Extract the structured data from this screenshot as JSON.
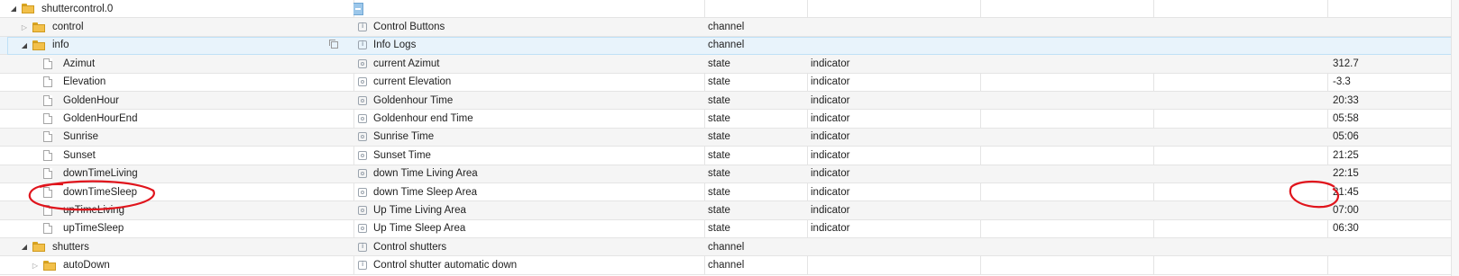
{
  "tree": {
    "rows": [
      {
        "name": "shuttercontrol.0",
        "kind": "folder",
        "arrow": "expanded",
        "indent": 0,
        "desc": "",
        "desc_icon": "header-button",
        "type": "",
        "role": "",
        "value": "",
        "selected": false
      },
      {
        "name": "control",
        "kind": "folder",
        "arrow": "collapsed",
        "indent": 1,
        "desc": "Control Buttons",
        "desc_icon": "info",
        "type": "channel",
        "role": "",
        "value": "",
        "selected": false
      },
      {
        "name": "info",
        "kind": "folder",
        "arrow": "expanded",
        "indent": 1,
        "desc": "Info Logs",
        "desc_icon": "info",
        "type": "channel",
        "role": "",
        "value": "",
        "selected": true
      },
      {
        "name": "Azimut",
        "kind": "state",
        "arrow": "",
        "indent": 2,
        "desc": "current Azimut",
        "desc_icon": "state",
        "type": "state",
        "role": "indicator",
        "value": "312.7",
        "selected": false
      },
      {
        "name": "Elevation",
        "kind": "state",
        "arrow": "",
        "indent": 2,
        "desc": "current Elevation",
        "desc_icon": "state",
        "type": "state",
        "role": "indicator",
        "value": "-3.3",
        "selected": false
      },
      {
        "name": "GoldenHour",
        "kind": "state",
        "arrow": "",
        "indent": 2,
        "desc": "Goldenhour Time",
        "desc_icon": "state",
        "type": "state",
        "role": "indicator",
        "value": "20:33",
        "selected": false
      },
      {
        "name": "GoldenHourEnd",
        "kind": "state",
        "arrow": "",
        "indent": 2,
        "desc": "Goldenhour end Time",
        "desc_icon": "state",
        "type": "state",
        "role": "indicator",
        "value": "05:58",
        "selected": false
      },
      {
        "name": "Sunrise",
        "kind": "state",
        "arrow": "",
        "indent": 2,
        "desc": "Sunrise Time",
        "desc_icon": "state",
        "type": "state",
        "role": "indicator",
        "value": "05:06",
        "selected": false
      },
      {
        "name": "Sunset",
        "kind": "state",
        "arrow": "",
        "indent": 2,
        "desc": "Sunset Time",
        "desc_icon": "state",
        "type": "state",
        "role": "indicator",
        "value": "21:25",
        "selected": false
      },
      {
        "name": "downTimeLiving",
        "kind": "state",
        "arrow": "",
        "indent": 2,
        "desc": "down Time Living Area",
        "desc_icon": "state",
        "type": "state",
        "role": "indicator",
        "value": "22:15",
        "selected": false
      },
      {
        "name": "downTimeSleep",
        "kind": "state",
        "arrow": "",
        "indent": 2,
        "desc": "down Time Sleep Area",
        "desc_icon": "state",
        "type": "state",
        "role": "indicator",
        "value": "21:45",
        "selected": false
      },
      {
        "name": "upTimeLiving",
        "kind": "state",
        "arrow": "",
        "indent": 2,
        "desc": "Up Time Living Area",
        "desc_icon": "state",
        "type": "state",
        "role": "indicator",
        "value": "07:00",
        "selected": false
      },
      {
        "name": "upTimeSleep",
        "kind": "state",
        "arrow": "",
        "indent": 2,
        "desc": "Up Time Sleep Area",
        "desc_icon": "state",
        "type": "state",
        "role": "indicator",
        "value": "06:30",
        "selected": false
      },
      {
        "name": "shutters",
        "kind": "folder",
        "arrow": "expanded",
        "indent": 1,
        "desc": "Control shutters",
        "desc_icon": "info",
        "type": "channel",
        "role": "",
        "value": "",
        "selected": false
      },
      {
        "name": "autoDown",
        "kind": "folder",
        "arrow": "collapsed",
        "indent": 2,
        "desc": "Control shutter automatic down",
        "desc_icon": "info",
        "type": "channel",
        "role": "",
        "value": "",
        "selected": false
      }
    ]
  },
  "annotation_color": "#e0141c"
}
